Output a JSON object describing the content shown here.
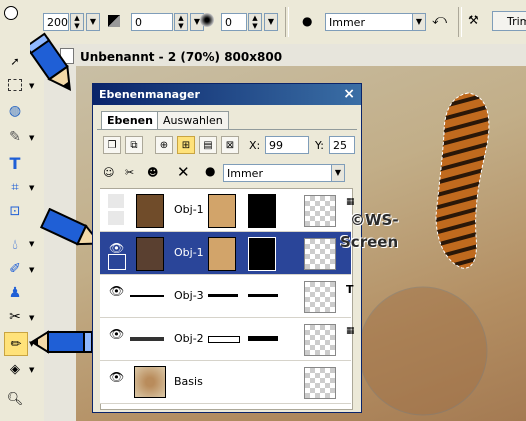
{
  "toolbar": {
    "size_value": "200",
    "opacity_value": "0",
    "hardness_value": "0",
    "mode_value": "Immer",
    "trim_label": "Trim"
  },
  "document": {
    "title": "Unbenannt - 2 (70%) 800x800"
  },
  "layer_manager": {
    "title": "Ebenenmanager",
    "close": "×",
    "tabs": [
      "Ebenen",
      "Auswahlen"
    ],
    "x_label": "X:",
    "x_value": "99",
    "y_label": "Y:",
    "y_value": "25",
    "blend_mode": "Immer",
    "layers": [
      {
        "name": "Obj-1",
        "visible": false,
        "selected": false
      },
      {
        "name": "Obj-1",
        "visible": true,
        "selected": true
      },
      {
        "name": "Obj-3",
        "visible": true,
        "selected": false
      },
      {
        "name": "Obj-2",
        "visible": true,
        "selected": false
      },
      {
        "name": "Basis",
        "visible": true,
        "selected": false
      }
    ]
  },
  "watermark": {
    "line1": "©WS-",
    "line2": "Screen"
  },
  "colors": {
    "selected_row": "#2a4599",
    "title_bar": "#0a246a",
    "pencil_blue": "#1f5fd6"
  }
}
